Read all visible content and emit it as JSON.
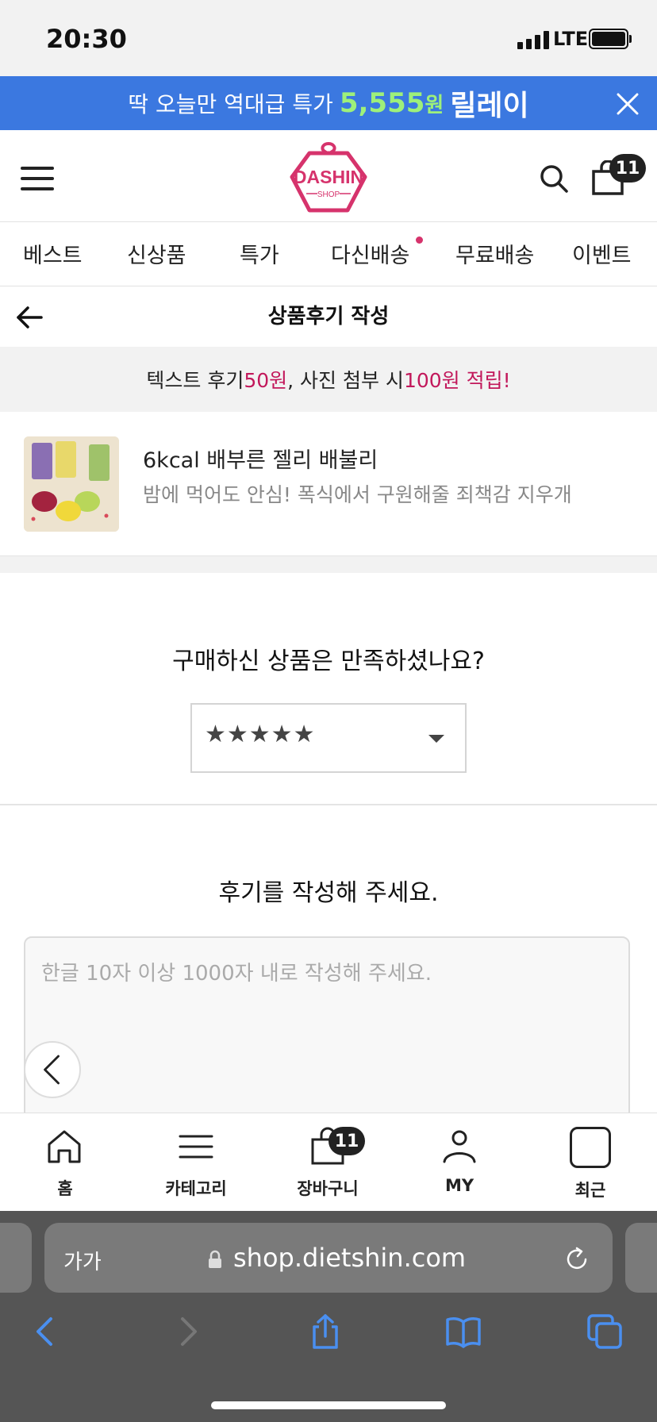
{
  "status_bar": {
    "time": "20:30",
    "network": "LTE"
  },
  "banner": {
    "prefix": "딱 오늘만 역대급 특가",
    "price": "5,555",
    "currency": "원",
    "suffix": "릴레이",
    "bg_color": "#3b78e0",
    "highlight_color": "#9ef07a"
  },
  "header": {
    "logo_text": "DASHIN",
    "logo_sub": "SHOP",
    "logo_color": "#d6336c",
    "cart_count": "11"
  },
  "nav": {
    "items": [
      "베스트",
      "신상품",
      "특가",
      "다신배송",
      "무료배송",
      "이벤트"
    ]
  },
  "page": {
    "title": "상품후기 작성"
  },
  "notice": {
    "part1": "텍스트 후기 ",
    "amount1": "50원",
    "part2": ", 사진 첨부 시 ",
    "amount2": "100원 적립!",
    "accent_color": "#c2185b"
  },
  "product": {
    "name": "6kcal 배부른 젤리 배불리",
    "desc": "밤에 먹어도 안심! 폭식에서 구원해줄 죄책감 지우개"
  },
  "rating": {
    "question": "구매하신 상품은 만족하셨나요?",
    "selected": "★★★★★"
  },
  "review": {
    "title": "후기를 작성해 주세요.",
    "placeholder": "한글 10자 이상 1000자 내로 작성해 주세요."
  },
  "tabbar": {
    "items": [
      "홈",
      "카테고리",
      "장바구니",
      "MY",
      "최근"
    ],
    "cart_count": "11"
  },
  "safari": {
    "text_size_label": "가가",
    "url": "shop.dietshin.com"
  }
}
